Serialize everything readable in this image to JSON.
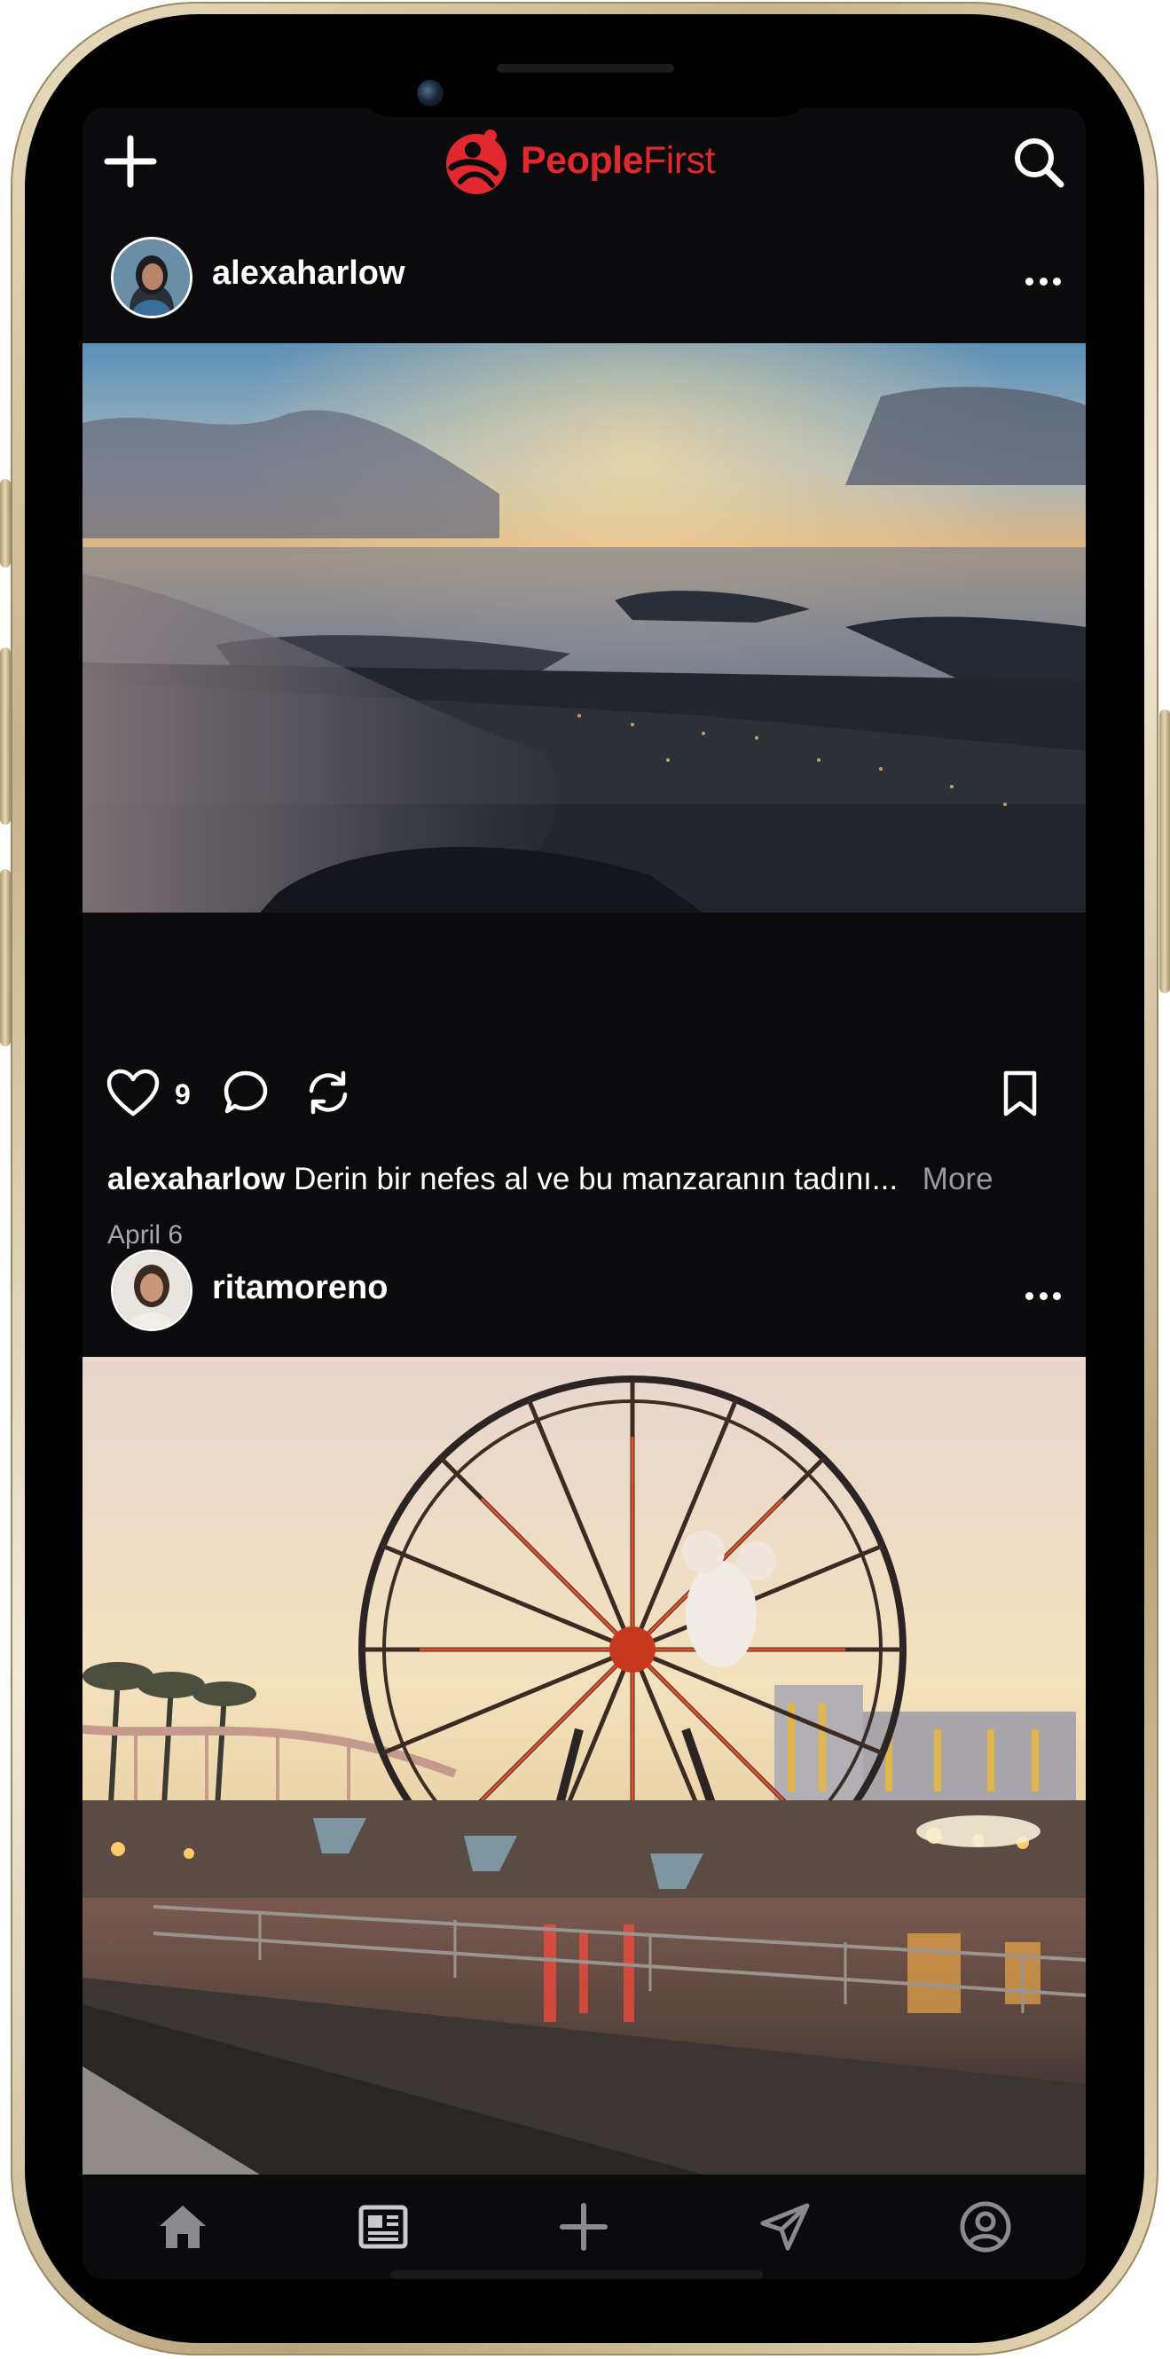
{
  "app": {
    "logo_text_a": "People",
    "logo_text_b": "First",
    "brand_color": "#e0282e",
    "background": "#0b0b0d"
  },
  "header": {
    "left_icon": "plus-icon",
    "right_icon": "search-icon"
  },
  "posts": [
    {
      "username": "alexaharlow",
      "like_count": "9",
      "caption_user": "alexaharlow",
      "caption_text": "Derin bir nefes al ve bu manzaranın tadını...",
      "more_label": "More",
      "date": "April 6",
      "image": "aerial-sunset-islands"
    },
    {
      "username": "ritamoreno",
      "image": "ferris-wheel-amusement-park"
    }
  ],
  "tabbar": {
    "items": [
      "home-icon",
      "news-icon",
      "add-icon",
      "send-icon",
      "profile-icon"
    ]
  }
}
